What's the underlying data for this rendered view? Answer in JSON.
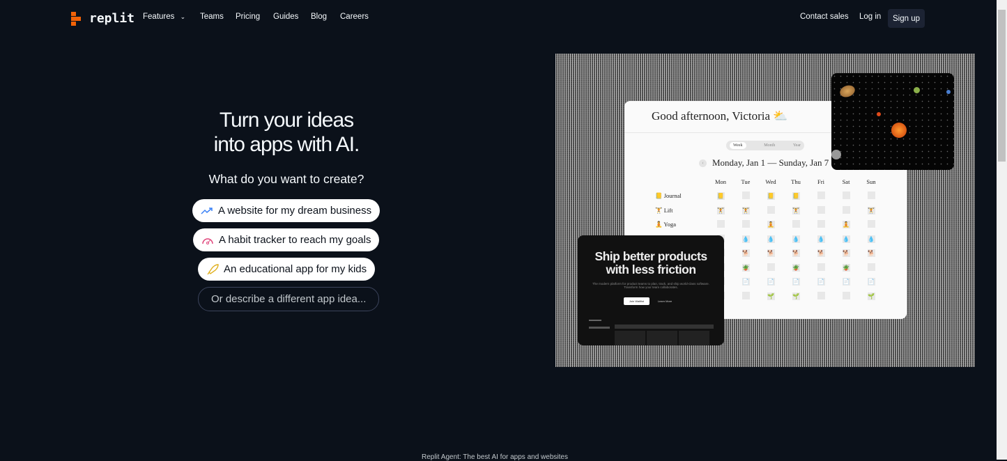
{
  "nav": {
    "brand": "replit",
    "links": [
      "Features",
      "Teams",
      "Pricing",
      "Guides",
      "Blog",
      "Careers"
    ],
    "contact": "Contact sales",
    "login": "Log in",
    "signup": "Sign up"
  },
  "hero": {
    "title_line1": "Turn your ideas",
    "title_line2": "into apps with AI.",
    "subtitle": "What do you want to create?",
    "chips": [
      {
        "label": "A website for my dream business",
        "icon": "trending-up-icon",
        "color": "#3b82f6"
      },
      {
        "label": "A habit tracker to reach my goals",
        "icon": "gauge-icon",
        "color": "#e0457b"
      },
      {
        "label": "An educational app for my kids",
        "icon": "rocket-icon",
        "color": "#e0b020"
      }
    ],
    "describe": "Or describe a different app idea..."
  },
  "preview": {
    "greeting": "Good afternoon, Victoria",
    "weather": "⛅",
    "tabs": [
      "Week",
      "Month",
      "Year"
    ],
    "range": "Monday, Jan 1 — Sunday, Jan 7",
    "days": [
      "Mon",
      "Tue",
      "Wed",
      "Thu",
      "Fri",
      "Sat",
      "Sun"
    ],
    "habits": [
      {
        "label": "Journal",
        "icon": "📒",
        "done": [
          1,
          0,
          1,
          1,
          0,
          0,
          0
        ]
      },
      {
        "label": "Lift",
        "icon": "🏋",
        "done": [
          1,
          1,
          0,
          1,
          0,
          0,
          1
        ]
      },
      {
        "label": "Yoga",
        "icon": "🧘",
        "done": [
          0,
          0,
          1,
          0,
          0,
          1,
          0
        ]
      },
      {
        "label": "",
        "icon": "💧",
        "done": [
          0,
          1,
          1,
          1,
          1,
          1,
          1
        ]
      },
      {
        "label": "",
        "icon": "🐕",
        "done": [
          0,
          1,
          1,
          1,
          1,
          1,
          1
        ]
      },
      {
        "label": "",
        "icon": "🪴",
        "done": [
          0,
          1,
          0,
          1,
          0,
          1,
          0
        ]
      },
      {
        "label": "",
        "icon": "📄",
        "done": [
          0,
          1,
          1,
          1,
          1,
          1,
          1
        ]
      },
      {
        "label": "",
        "icon": "🌱",
        "done": [
          0,
          0,
          1,
          1,
          0,
          0,
          1
        ]
      }
    ],
    "dark_card": {
      "title_line1": "Ship better products",
      "title_line2": "with less friction",
      "body": "The modern platform for product teams to plan, track, and ship world-class software. Transform how your team collaborates.",
      "primary": "Join Waitlist",
      "secondary": "Learn More"
    }
  },
  "footer": {
    "text": "Replit Agent: The best AI for apps and websites"
  },
  "colors": {
    "background": "#0b111a",
    "brand": "#f26207"
  }
}
